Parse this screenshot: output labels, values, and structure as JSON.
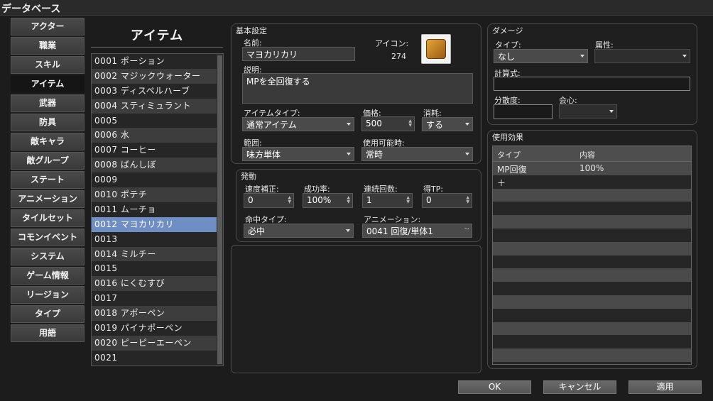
{
  "window": {
    "title": "データベース"
  },
  "categories": [
    {
      "label": "アクター"
    },
    {
      "label": "職業"
    },
    {
      "label": "スキル"
    },
    {
      "label": "アイテム"
    },
    {
      "label": "武器"
    },
    {
      "label": "防具"
    },
    {
      "label": "敵キャラ"
    },
    {
      "label": "敵グループ"
    },
    {
      "label": "ステート"
    },
    {
      "label": "アニメーション"
    },
    {
      "label": "タイルセット"
    },
    {
      "label": "コモンイベント"
    },
    {
      "label": "システム"
    },
    {
      "label": "ゲーム情報"
    },
    {
      "label": "リージョン"
    },
    {
      "label": "タイプ"
    },
    {
      "label": "用語"
    }
  ],
  "active_category": "アイテム",
  "item_list": {
    "title": "アイテム",
    "selected": "0012 マヨカリカリ",
    "items": [
      "0001 ポーション",
      "0002 マジックウォーター",
      "0003 ディスペルハーブ",
      "0004 スティミュラント",
      "0005",
      "0006 水",
      "0007 コーヒー",
      "0008 ばんしぼ",
      "0009",
      "0010 ポテチ",
      "0011 ムーチョ",
      "0012 マヨカリカリ",
      "0013",
      "0014 ミルチー",
      "0015",
      "0016 にくむすび",
      "0017",
      "0018 アポーペン",
      "0019 パイナポーペン",
      "0020 ピーピーエーペン",
      "0021"
    ]
  },
  "basic": {
    "title": "基本設定",
    "name_label": "名前:",
    "name_value": "マヨカリカリ",
    "icon_label": "アイコン:",
    "icon_index": "274",
    "icon_name": "item-bag-icon",
    "desc_label": "説明:",
    "desc_value": "MPを全回復する",
    "item_type_label": "アイテムタイプ:",
    "item_type_value": "通常アイテム",
    "price_label": "価格:",
    "price_value": "500",
    "consume_label": "消耗:",
    "consume_value": "する",
    "scope_label": "範囲:",
    "scope_value": "味方単体",
    "occasion_label": "使用可能時:",
    "occasion_value": "常時"
  },
  "invocation": {
    "title": "発動",
    "speed_label": "速度補正:",
    "speed_value": "0",
    "success_label": "成功率:",
    "success_value": "100%",
    "repeats_label": "連続回数:",
    "repeats_value": "1",
    "tp_label": "得TP:",
    "tp_value": "0",
    "hit_type_label": "命中タイプ:",
    "hit_type_value": "必中",
    "animation_label": "アニメーション:",
    "animation_value": "0041 回復/単体1"
  },
  "damage": {
    "title": "ダメージ",
    "type_label": "タイプ:",
    "type_value": "なし",
    "element_label": "属性:",
    "element_value": "",
    "formula_label": "計算式:",
    "formula_value": "",
    "variance_label": "分散度:",
    "variance_value": "",
    "critical_label": "会心:",
    "critical_value": ""
  },
  "effects": {
    "title": "使用効果",
    "col_type": "タイプ",
    "col_content": "内容",
    "rows": [
      {
        "type": "MP回復",
        "content": "100%"
      },
      {
        "type": "＋",
        "content": ""
      }
    ]
  },
  "buttons": {
    "ok": "OK",
    "cancel": "キャンセル",
    "apply": "適用"
  }
}
